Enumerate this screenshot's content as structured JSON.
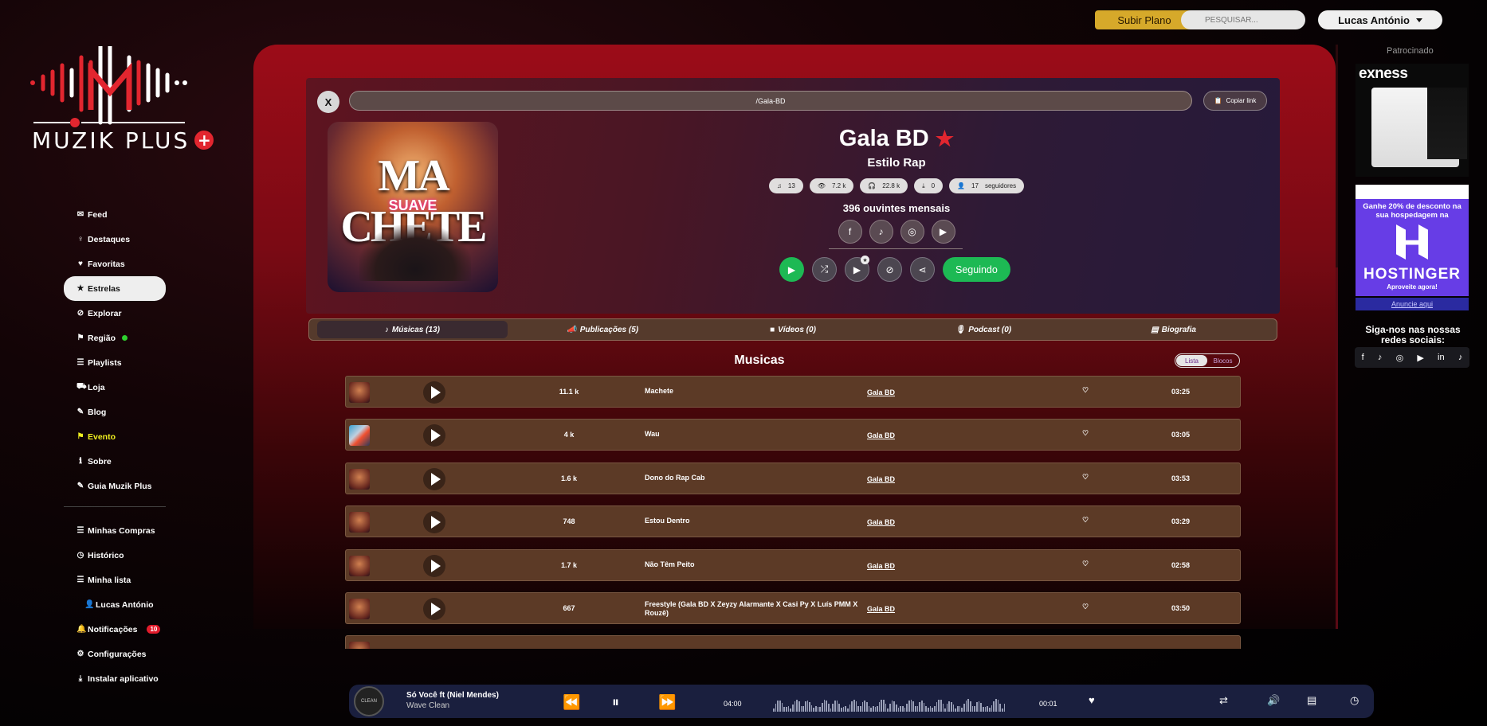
{
  "topbar": {
    "plan_label": "Subir Plano",
    "search_placeholder": "PESQUISAR...",
    "user_name": "Lucas António"
  },
  "logo": {
    "text": "MUZIK PLUS"
  },
  "nav": {
    "items": [
      {
        "label": "Feed",
        "icon": "chat-icon"
      },
      {
        "label": "Destaques",
        "icon": "bulb-icon"
      },
      {
        "label": "Favoritas",
        "icon": "heart-icon"
      },
      {
        "label": "Estrelas",
        "icon": "star-icon",
        "active": true
      },
      {
        "label": "Explorar",
        "icon": "compass-icon"
      },
      {
        "label": "Região",
        "icon": "flag-icon"
      },
      {
        "label": "Playlists",
        "icon": "list-icon"
      },
      {
        "label": "Loja",
        "icon": "cart-icon"
      },
      {
        "label": "Blog",
        "icon": "blog-icon"
      },
      {
        "label": "Evento",
        "icon": "flag-icon"
      },
      {
        "label": "Sobre",
        "icon": "info-icon"
      },
      {
        "label": "Guia Muzik Plus",
        "icon": "guide-icon"
      }
    ],
    "items2": [
      {
        "label": "Minhas Compras",
        "icon": "list-icon"
      },
      {
        "label": "Histórico",
        "icon": "clock-icon"
      },
      {
        "label": "Minha lista",
        "icon": "list-icon"
      },
      {
        "label": "Lucas António",
        "icon": "user-icon"
      },
      {
        "label": "Notificações",
        "icon": "bell-icon",
        "badge": "10"
      },
      {
        "label": "Configurações",
        "icon": "gear-icon"
      },
      {
        "label": "Instalar aplicativo",
        "icon": "download-icon"
      }
    ]
  },
  "header": {
    "close_label": "X",
    "url": "/Gala-BD",
    "copy_label": "Copiar link",
    "cover_title": "MA CHETE",
    "cover_sub": "SUAVE",
    "artist": "Gala BD",
    "star": "★",
    "genre": "Estilo Rap",
    "stats": {
      "songs": "13",
      "views": "7.2 k",
      "listens": "22.8 k",
      "downloads": "0",
      "followers": "17",
      "followers_label": "seguidores"
    },
    "listeners": "396 ouvintes mensais",
    "follow_label": "Seguindo"
  },
  "tabs": [
    {
      "label": "Músicas (13)",
      "icon": "note-icon",
      "active": true
    },
    {
      "label": "Publicações (5)",
      "icon": "megaphone-icon"
    },
    {
      "label": "Vídeos (0)",
      "icon": "video-icon"
    },
    {
      "label": "Podcast (0)",
      "icon": "mic-icon"
    },
    {
      "label": "Biografia",
      "icon": "id-card-icon"
    }
  ],
  "section": {
    "title": "Musicas",
    "view_list": "Lista",
    "view_blocks": "Blocos"
  },
  "tracks": [
    {
      "plays": "11.1 k",
      "name": "Machete",
      "artist": "Gala BD",
      "duration": "03:25"
    },
    {
      "plays": "4 k",
      "name": "Wau",
      "artist": "Gala BD",
      "duration": "03:05"
    },
    {
      "plays": "1.6 k",
      "name": "Dono do Rap Cab",
      "artist": "Gala BD",
      "duration": "03:53"
    },
    {
      "plays": "748",
      "name": "Estou Dentro",
      "artist": "Gala BD",
      "duration": "03:29"
    },
    {
      "plays": "1.7 k",
      "name": "Não Têm Peito",
      "artist": "Gala BD",
      "duration": "02:58"
    },
    {
      "plays": "667",
      "name": "Freestyle (Gala BD X Zeyzy Alarmante X Casi Py X Luís PMM X Rouzê)",
      "artist": "Gala BD",
      "duration": "03:50"
    }
  ],
  "player": {
    "title": "Só Você ft (Niel Mendes)",
    "artist": "Wave Clean",
    "time_total": "04:00",
    "time_elapsed": "00:01"
  },
  "sidebar_right": {
    "sponsored": "Patrocinado",
    "ad1_brand": "exness",
    "ad2_text": "Ganhe 20% de desconto na sua hospedagem na",
    "ad2_brand": "HOSTINGER",
    "ad2_sub": "Aproveite agora!",
    "ad_link": "Anuncie aqui",
    "follow_text": "Siga-nos nas nossas redes sociais:"
  }
}
